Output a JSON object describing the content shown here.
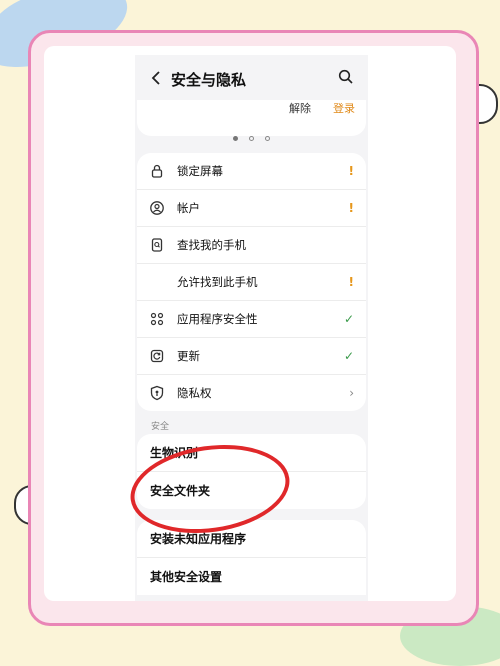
{
  "header": {
    "title": "安全与隐私"
  },
  "top_card": {
    "left_text": "解除",
    "right_text": "登录"
  },
  "carousel": {
    "active_index": 0,
    "count": 3
  },
  "main_list": [
    {
      "label": "锁定屏幕",
      "icon": "lock-icon",
      "status": "!"
    },
    {
      "label": "帐户",
      "icon": "account-icon",
      "status": "!"
    },
    {
      "label": "查找我的手机",
      "icon": "find-phone-icon",
      "status": ""
    },
    {
      "label": "允许找到此手机",
      "icon": "",
      "status": "!"
    },
    {
      "label": "应用程序安全性",
      "icon": "apps-grid-icon",
      "status": "✓"
    },
    {
      "label": "更新",
      "icon": "update-icon",
      "status": "✓"
    },
    {
      "label": "隐私权",
      "icon": "privacy-shield-icon",
      "status": "›"
    }
  ],
  "section_label": "安全",
  "security_list": [
    {
      "label": "生物识别"
    },
    {
      "label": "安全文件夹"
    }
  ],
  "other_list": [
    {
      "label": "安装未知应用程序"
    },
    {
      "label": "其他安全设置"
    }
  ],
  "colors": {
    "warning": "#e6971c",
    "ok": "#3a9a4a",
    "annotation_circle": "#e0282a",
    "frame_pink": "#e986b6"
  }
}
